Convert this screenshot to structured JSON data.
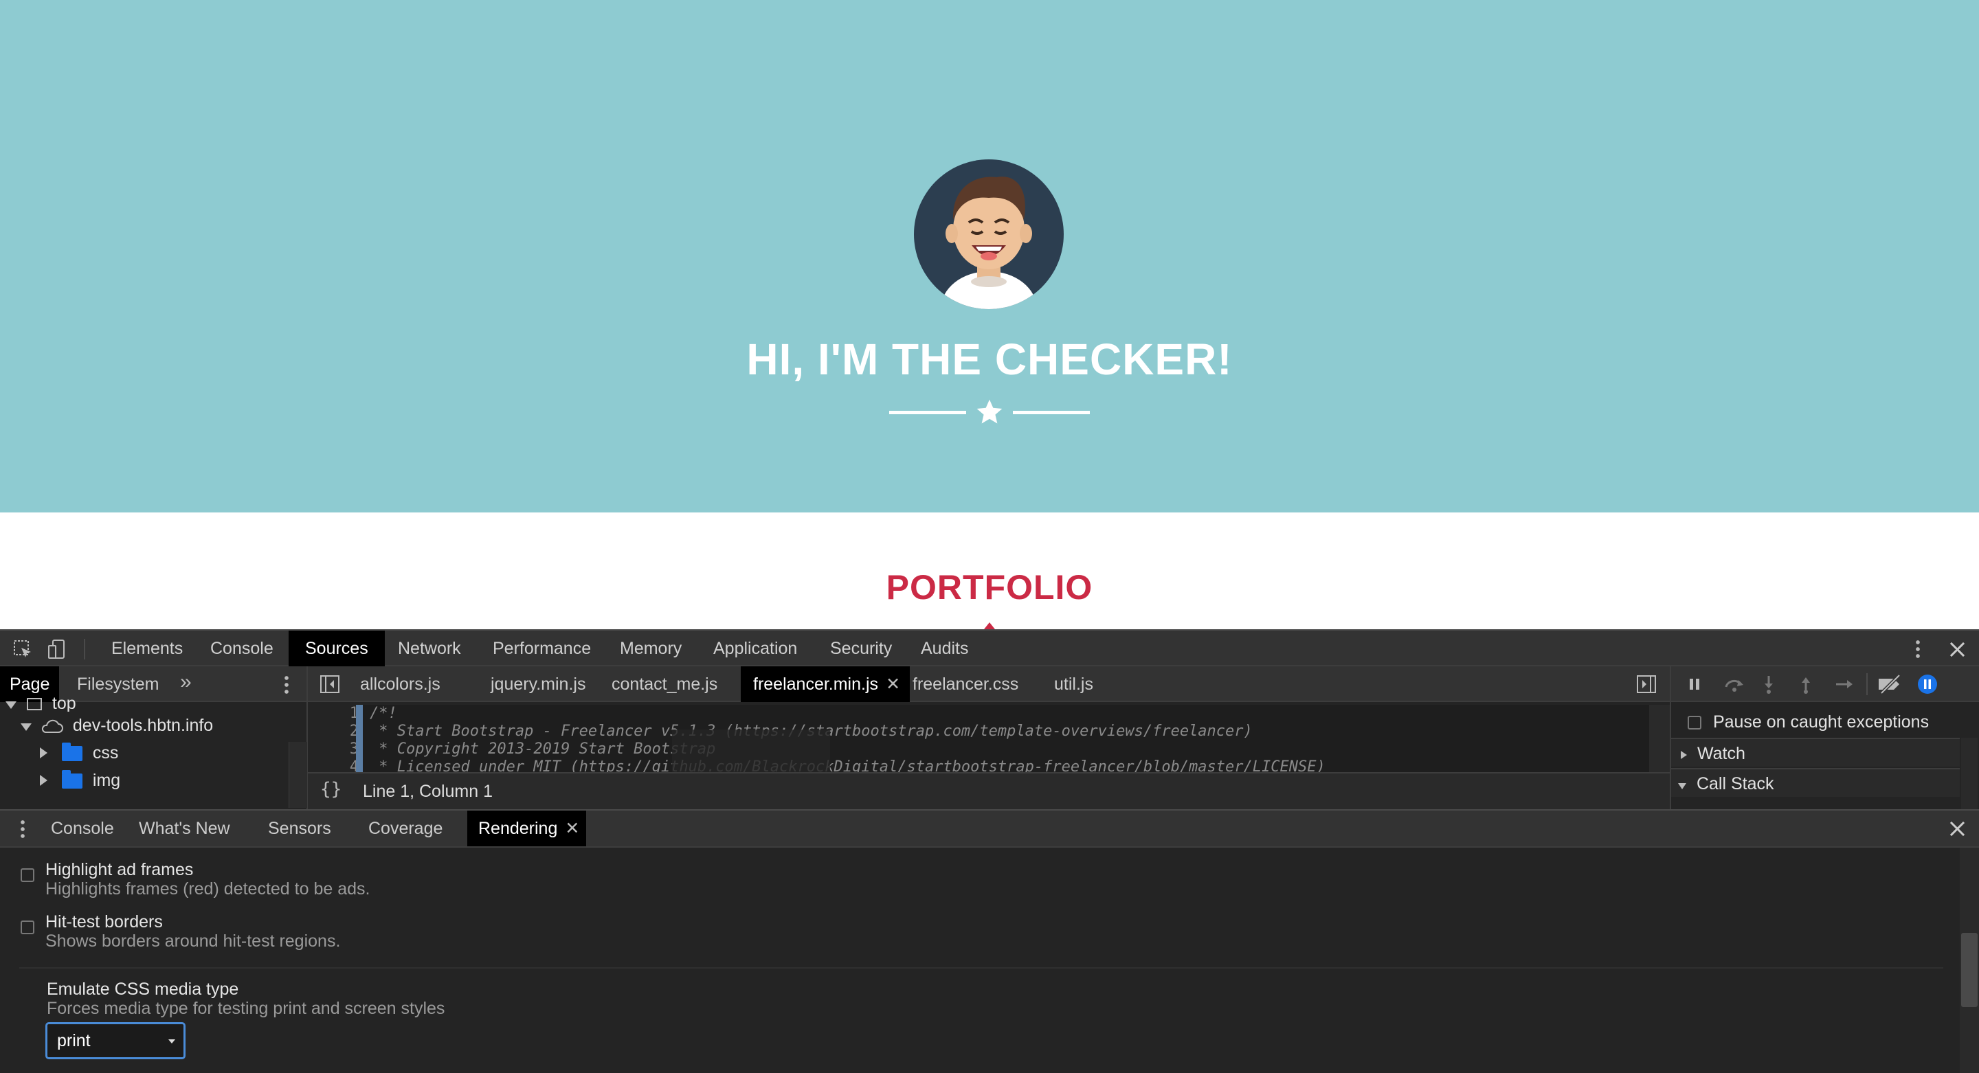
{
  "page": {
    "hero_title": "HI, I'M THE CHECKER!",
    "portfolio_title": "PORTFOLIO",
    "colors": {
      "hero_bg": "#8ecbd1",
      "accent": "#cb2a45"
    }
  },
  "devtools": {
    "main_tabs": [
      "Elements",
      "Console",
      "Sources",
      "Network",
      "Performance",
      "Memory",
      "Application",
      "Security",
      "Audits"
    ],
    "active_main_tab": "Sources",
    "navigator": {
      "tabs": [
        "Page",
        "Filesystem"
      ],
      "active_tab": "Page",
      "tree": [
        "top",
        "dev-tools.hbtn.info",
        "css",
        "img"
      ]
    },
    "editor": {
      "tabs": [
        "allcolors.js",
        "jquery.min.js",
        "contact_me.js",
        "freelancer.min.js",
        "freelancer.css",
        "util.js"
      ],
      "active_tab": "freelancer.min.js",
      "line_numbers": [
        "1",
        "2",
        "3",
        "4"
      ],
      "code_lines": [
        "/*!",
        " * Start Bootstrap - Freelancer v5.1.3 (https://startbootstrap.com/template-overviews/freelancer)",
        " * Copyright 2013-2019 Start Bootstrap",
        " * Licensed under MIT (https://github.com/BlackrockDigital/startbootstrap-freelancer/blob/master/LICENSE)"
      ],
      "status": "Line 1, Column 1",
      "format_label": "{}"
    },
    "debugger": {
      "pause_caught": "Pause on caught exceptions",
      "watch": "Watch",
      "call_stack": "Call Stack"
    },
    "drawer": {
      "tabs": [
        "Console",
        "What's New",
        "Sensors",
        "Coverage",
        "Rendering"
      ],
      "active_tab": "Rendering",
      "options": [
        {
          "title": "Highlight ad frames",
          "desc": "Highlights frames (red) detected to be ads."
        },
        {
          "title": "Hit-test borders",
          "desc": "Shows borders around hit-test regions."
        }
      ],
      "media": {
        "title": "Emulate CSS media type",
        "desc": "Forces media type for testing print and screen styles",
        "value": "print"
      }
    }
  }
}
